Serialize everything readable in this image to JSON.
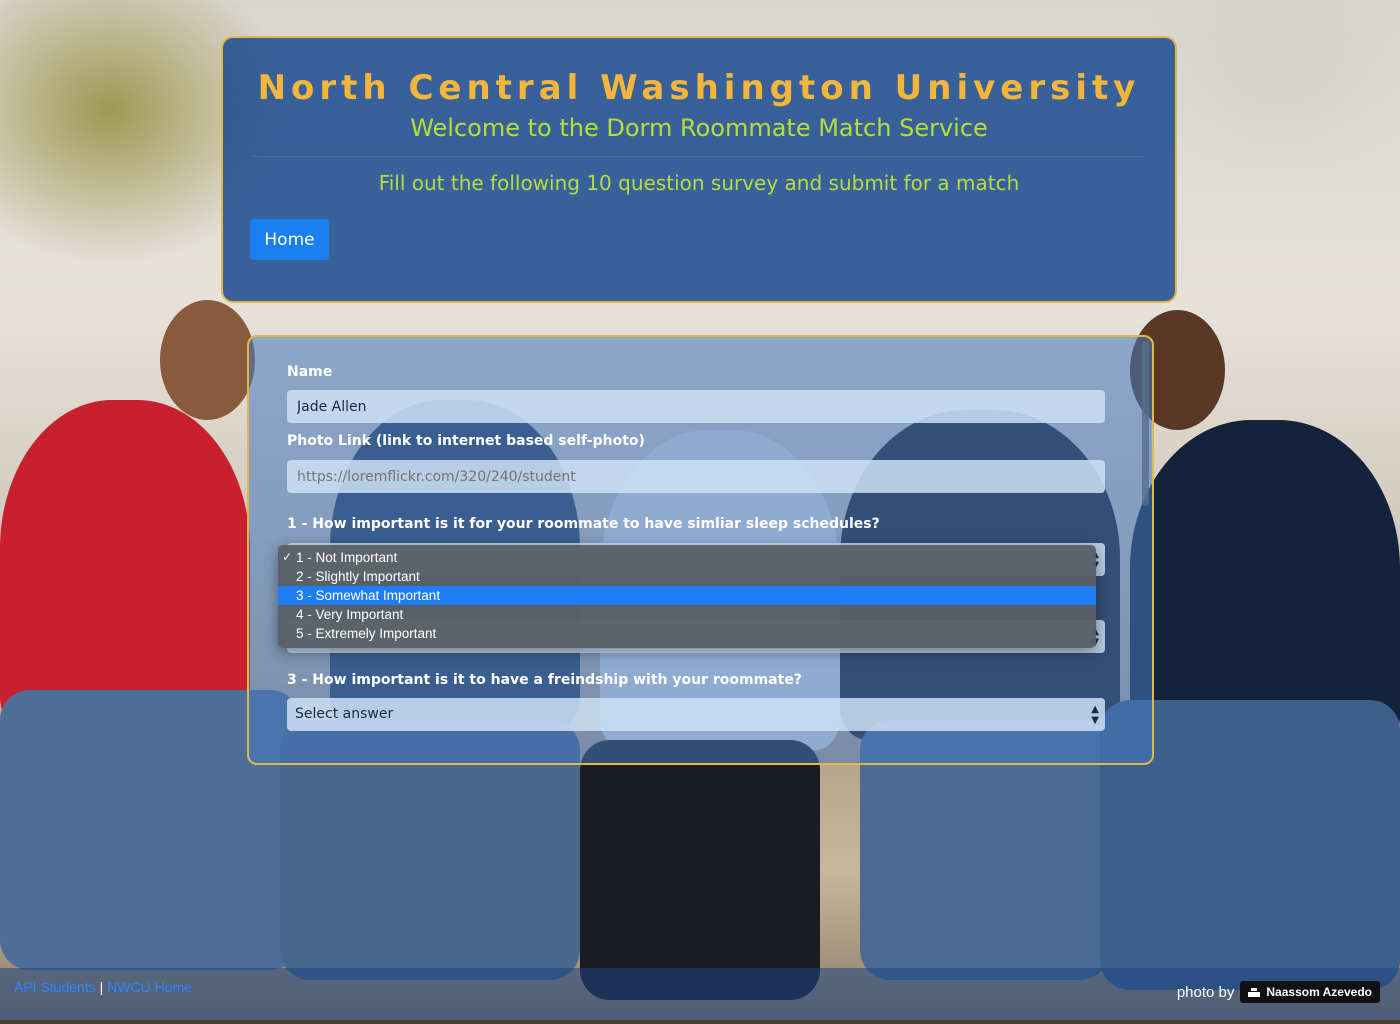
{
  "header": {
    "university": "North Central Washington University",
    "welcome": "Welcome to the Dorm Roommate Match Service",
    "instructions": "Fill out the following 10 question survey and submit for a match",
    "home_label": "Home"
  },
  "form": {
    "name_label": "Name",
    "name_value": "Jade Allen",
    "photo_label": "Photo Link (link to internet based self-photo)",
    "photo_placeholder": "https://loremflickr.com/320/240/student",
    "q1_label": "1 - How important is it for your roommate to have simliar sleep schedules?",
    "q3_label": "3 - How important is it to have a freindship with your roommate?",
    "q3_value": "Select answer"
  },
  "dropdown": {
    "options": [
      {
        "label": "1 - Not Important",
        "checked": true
      },
      {
        "label": "2 - Slightly Important"
      },
      {
        "label": "3 - Somewhat Important",
        "highlighted": true
      },
      {
        "label": "4 - Very Important"
      },
      {
        "label": "5 - Extremely Important"
      }
    ]
  },
  "footer": {
    "link_students": "API Students",
    "separator": "|",
    "link_home": "NWCU Home",
    "photo_by": "photo by",
    "photographer": "Naassom Azevedo"
  },
  "colors": {
    "title": "#f3b63a",
    "subtitle": "#b6dd3c",
    "primary_button": "#1a7ff0",
    "highlight": "#1f7ef5"
  }
}
